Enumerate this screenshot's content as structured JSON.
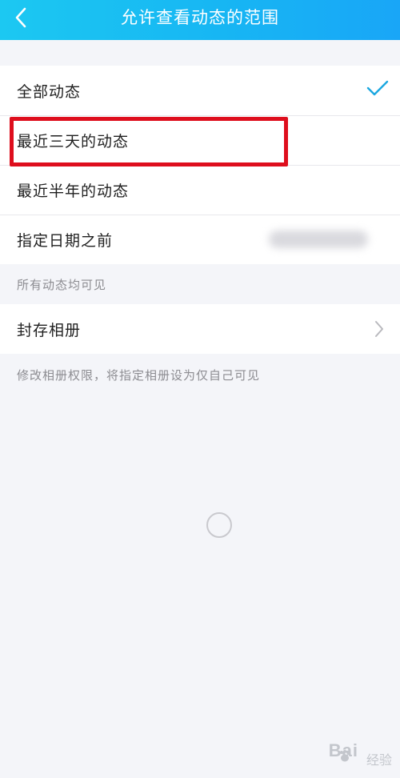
{
  "header": {
    "title": "允许查看动态的范围",
    "background": "#17b6f3"
  },
  "visibility_options": [
    {
      "label": "全部动态",
      "selected": true
    },
    {
      "label": "最近三天的动态",
      "selected": false
    },
    {
      "label": "最近半年的动态",
      "selected": false
    },
    {
      "label": "指定日期之前",
      "selected": false
    }
  ],
  "visibility_hint": "所有动态均可见",
  "album": {
    "label": "封存相册",
    "hint": "修改相册权限，将指定相册设为仅自己可见"
  },
  "colors": {
    "accent": "#1aa7e0",
    "highlight": "#de0e1d"
  },
  "watermark": {
    "logo": "Bai",
    "suffix": "经验"
  }
}
